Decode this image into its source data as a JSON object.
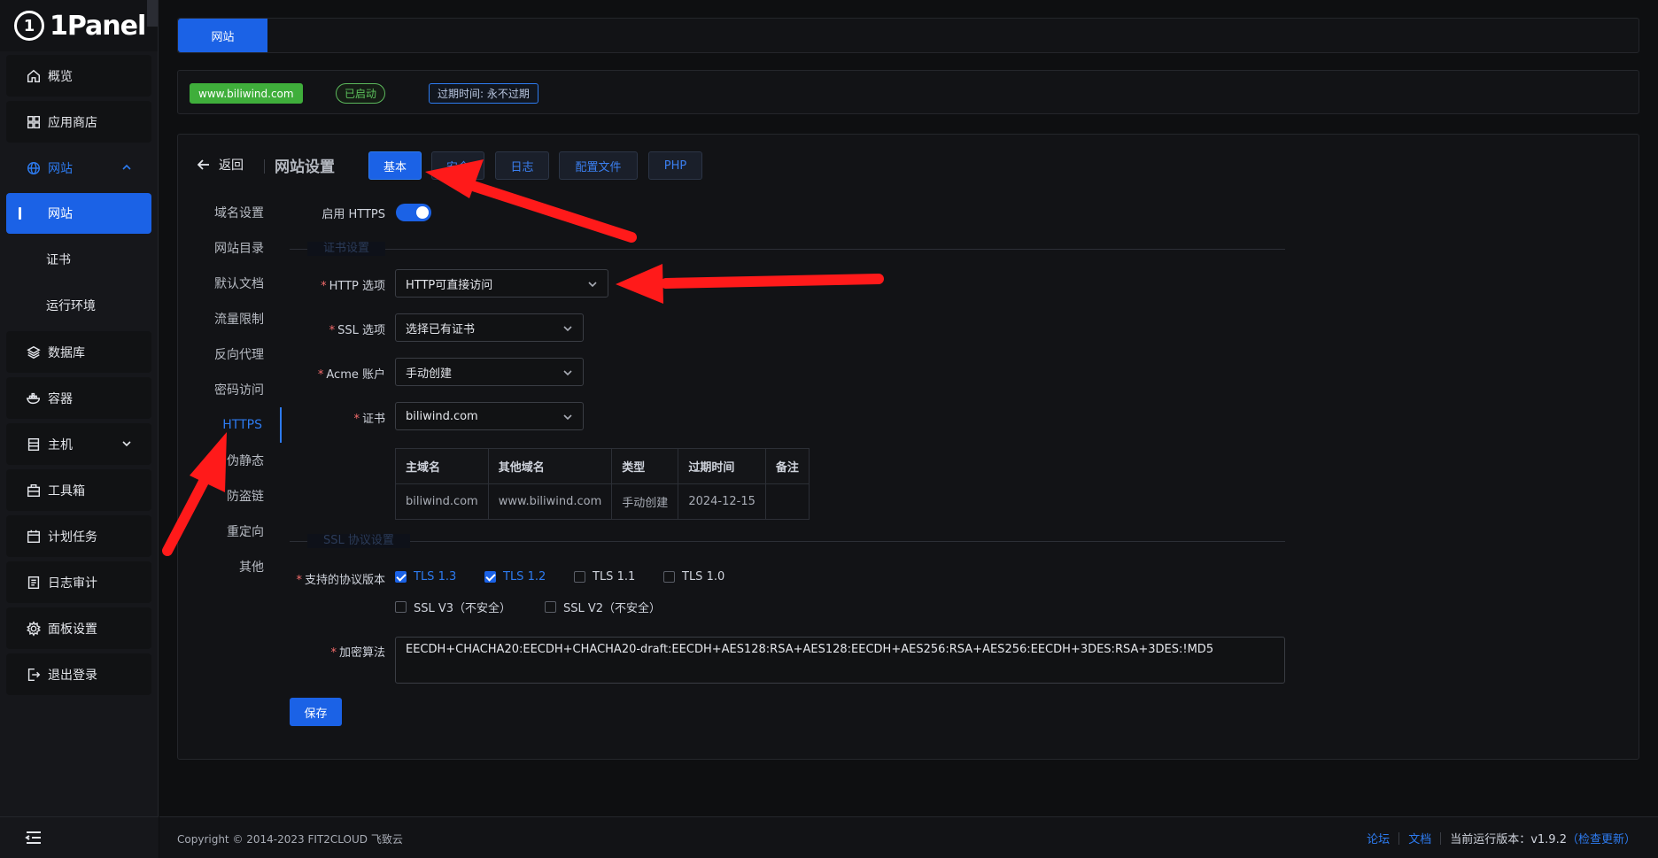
{
  "brand": {
    "name": "1Panel",
    "logo_mark": "1"
  },
  "sidebar": {
    "items": [
      {
        "label": "概览",
        "icon": "home-icon"
      },
      {
        "label": "应用商店",
        "icon": "grid-icon"
      },
      {
        "label": "网站",
        "icon": "globe-icon",
        "expanded": true
      },
      {
        "label": "网站",
        "sub": true,
        "active": true
      },
      {
        "label": "证书",
        "sub": true
      },
      {
        "label": "运行环境",
        "sub": true
      },
      {
        "label": "数据库",
        "icon": "layers-icon"
      },
      {
        "label": "容器",
        "icon": "docker-icon"
      },
      {
        "label": "主机",
        "icon": "server-icon",
        "has_chevron": true
      },
      {
        "label": "工具箱",
        "icon": "toolbox-icon"
      },
      {
        "label": "计划任务",
        "icon": "calendar-icon"
      },
      {
        "label": "日志审计",
        "icon": "log-icon"
      },
      {
        "label": "面板设置",
        "icon": "gear-icon"
      },
      {
        "label": "退出登录",
        "icon": "logout-icon"
      }
    ]
  },
  "topbar": {
    "tab_label": "网站"
  },
  "infobar": {
    "domain": "www.biliwind.com",
    "status": "已启动",
    "expire": "过期时间: 永不过期"
  },
  "panel": {
    "back_label": "返回",
    "title": "网站设置",
    "tabs": [
      "基本",
      "安全",
      "日志",
      "配置文件",
      "PHP"
    ],
    "subnav": [
      "域名设置",
      "网站目录",
      "默认文档",
      "流量限制",
      "反向代理",
      "密码访问",
      "HTTPS",
      "伪静态",
      "防盗链",
      "重定向",
      "其他"
    ],
    "subnav_active": "HTTPS"
  },
  "https_form": {
    "enable_label": "启用 HTTPS",
    "cert_section": "证书设置",
    "http_option_label": "HTTP 选项",
    "http_option_value": "HTTP可直接访问",
    "ssl_option_label": "SSL 选项",
    "ssl_option_value": "选择已有证书",
    "acme_label": "Acme 账户",
    "acme_value": "手动创建",
    "cert_label": "证书",
    "cert_value": "biliwind.com",
    "table": {
      "headers": [
        "主域名",
        "其他域名",
        "类型",
        "过期时间",
        "备注"
      ],
      "rows": [
        [
          "biliwind.com",
          "www.biliwind.com",
          "手动创建",
          "2024-12-15",
          ""
        ]
      ]
    },
    "ssl_section": "SSL 协议设置",
    "protocols_label": "支持的协议版本",
    "protocols": [
      {
        "label": "TLS 1.3",
        "checked": true
      },
      {
        "label": "TLS 1.2",
        "checked": true
      },
      {
        "label": "TLS 1.1",
        "checked": false
      },
      {
        "label": "TLS 1.0",
        "checked": false
      },
      {
        "label": "SSL V3（不安全）",
        "checked": false
      },
      {
        "label": "SSL V2（不安全）",
        "checked": false
      }
    ],
    "cipher_label": "加密算法",
    "cipher_value": "EECDH+CHACHA20:EECDH+CHACHA20-draft:EECDH+AES128:RSA+AES128:EECDH+AES256:RSA+AES256:EECDH+3DES:RSA+3DES:!MD5",
    "save_label": "保存"
  },
  "footer": {
    "copyright": "Copyright © 2014-2023 FIT2CLOUD 飞致云",
    "forum": "论坛",
    "docs": "文档",
    "version_text": "当前运行版本：v1.9.2",
    "check_update": "（检查更新）"
  },
  "colors": {
    "accent": "#1b62e6",
    "success": "#3fae3b",
    "annotation": "#ff1a1a"
  }
}
